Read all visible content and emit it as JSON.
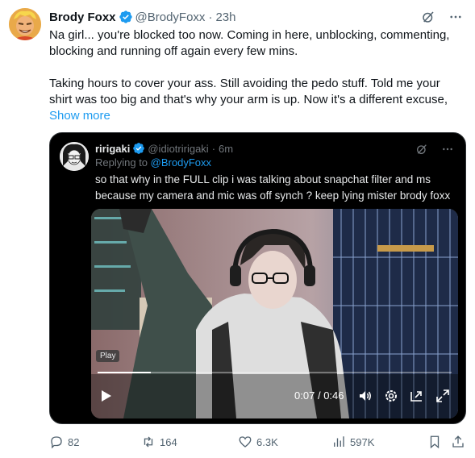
{
  "tweet": {
    "author_name": "Brody Foxx",
    "author_handle": "@BrodyFoxx",
    "separator": "·",
    "time": "23h",
    "text_lines": [
      "Na girl... you're blocked too now. Coming in here, unblocking, commenting, blocking and running off again every few mins.",
      "Taking hours to cover your ass. Still avoiding the pedo stuff. Told me your shirt was too big and that's why your arm is up. Now it's a different excuse,"
    ],
    "show_more": "Show more",
    "icons": {
      "verified": "verified-badge-icon",
      "grok": "grok-icon",
      "more": "more-icon"
    }
  },
  "quote": {
    "author_name": "ririgaki",
    "author_handle": "@idiotririgaki",
    "separator": "·",
    "time": "6m",
    "replying_prefix": "Replying to",
    "replying_to": "@BrodyFoxx",
    "text": "so that why in the FULL clip i was talking about snapchat filter and ms because my camera and mic was off synch ? keep lying mister brody foxx",
    "video": {
      "badge": "Play",
      "current_time": "0:07",
      "time_separator": "/",
      "duration": "0:46",
      "progress": 0.15
    }
  },
  "actions": {
    "replies": "82",
    "reposts": "164",
    "likes": "6.3K",
    "views": "597K"
  },
  "colors": {
    "accent": "#1d9bf0",
    "text": "#0f1419",
    "muted": "#536471"
  }
}
